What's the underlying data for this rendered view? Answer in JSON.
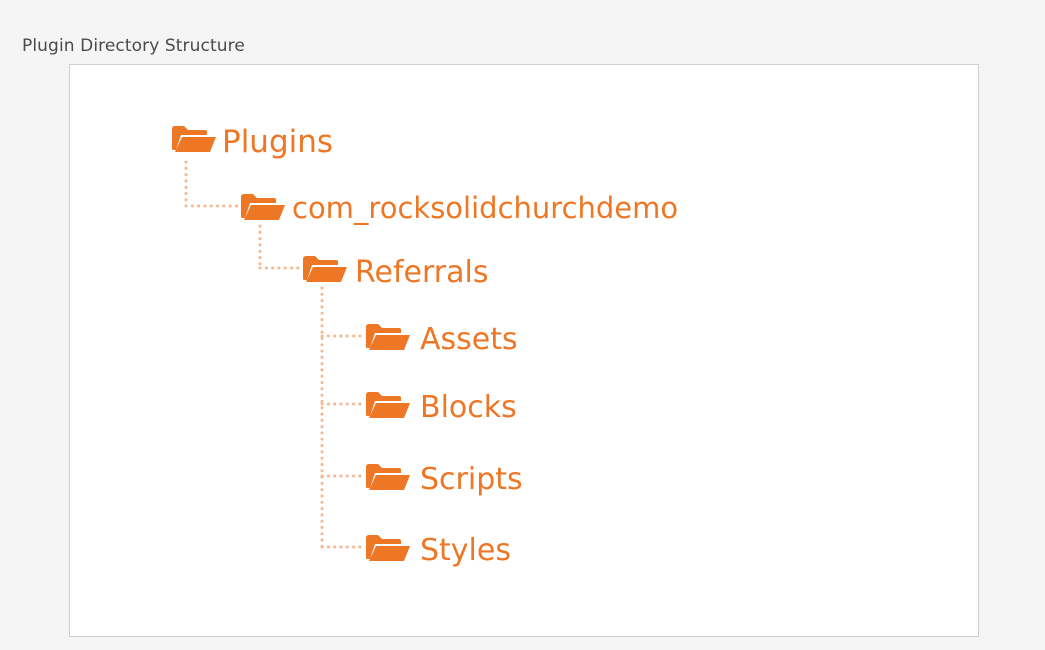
{
  "caption": "Plugin Directory Structure",
  "accent_color": "#ee7725",
  "connector_color": "#f6b88f",
  "tree": {
    "icon": "folder-open-icon",
    "root": {
      "label": "Plugins"
    },
    "level1": {
      "label": "com_rocksolidchurchdemo"
    },
    "level2": {
      "label": "Referrals"
    },
    "children": [
      {
        "label": "Assets"
      },
      {
        "label": "Blocks"
      },
      {
        "label": "Scripts"
      },
      {
        "label": "Styles"
      }
    ]
  }
}
